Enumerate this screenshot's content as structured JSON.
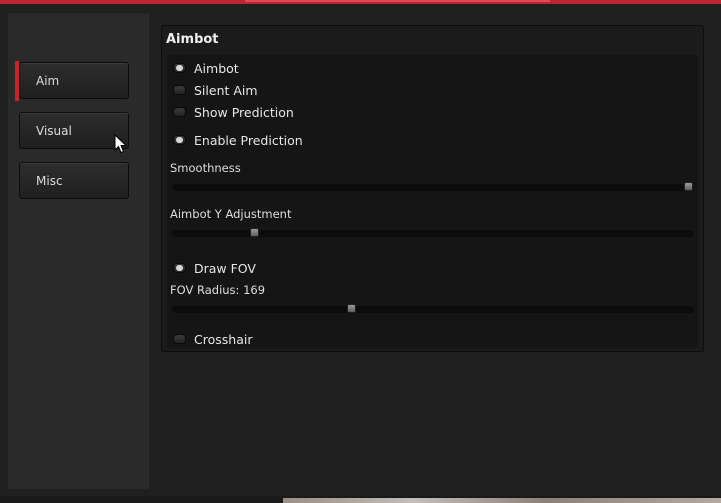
{
  "sidebar": {
    "tabs": [
      {
        "label": "Aim",
        "active": true
      },
      {
        "label": "Visual",
        "active": false
      },
      {
        "label": "Misc",
        "active": false
      }
    ]
  },
  "panel": {
    "title": "Aimbot",
    "options": {
      "aimbot": {
        "label": "Aimbot",
        "checked": true
      },
      "silent_aim": {
        "label": "Silent Aim",
        "checked": false
      },
      "show_prediction": {
        "label": "Show Prediction",
        "checked": false
      },
      "enable_prediction": {
        "label": "Enable Prediction",
        "checked": true
      },
      "draw_fov": {
        "label": "Draw FOV",
        "checked": true
      },
      "crosshair": {
        "label": "Crosshair",
        "checked": false
      }
    },
    "sliders": {
      "smoothness": {
        "label": "Smoothness",
        "level": 1.0
      },
      "y_adjustment": {
        "label": "Aimbot Y Adjustment",
        "level": 0.15
      },
      "fov_radius": {
        "label": "FOV Radius: 169",
        "level": 0.34
      }
    }
  },
  "colors": {
    "accent": "#c9232c",
    "panel_bg": "#1b1b1b",
    "text": "#e6e6e6"
  }
}
